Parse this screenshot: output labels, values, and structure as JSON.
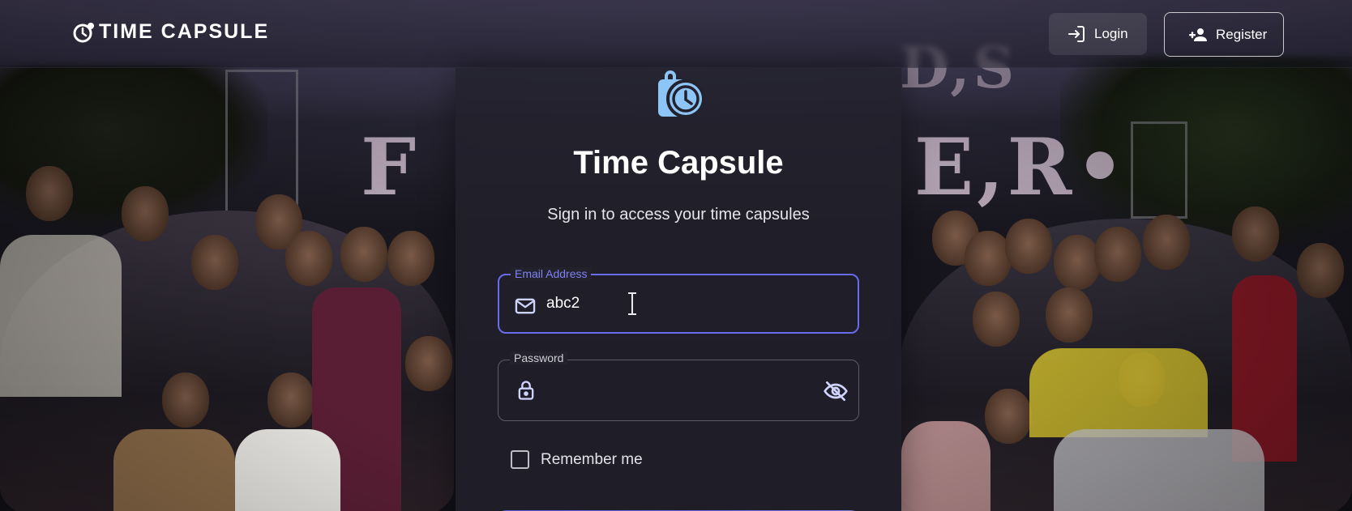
{
  "header": {
    "brand": "TIME CAPSULE",
    "login_label": "Login",
    "register_label": "Register"
  },
  "card": {
    "title": "Time Capsule",
    "subtitle": "Sign in to access your time capsules",
    "email": {
      "label": "Email Address",
      "value": "abc2",
      "icon": "mail-icon"
    },
    "password": {
      "label": "Password",
      "value": "",
      "icon": "lock-icon",
      "toggle_icon": "eye-off-icon"
    },
    "remember_label": "Remember me",
    "remember_checked": false
  },
  "colors": {
    "accent": "#6a6cf0",
    "icon_blue": "#8ec5f7",
    "card_bg": "#22212c"
  }
}
